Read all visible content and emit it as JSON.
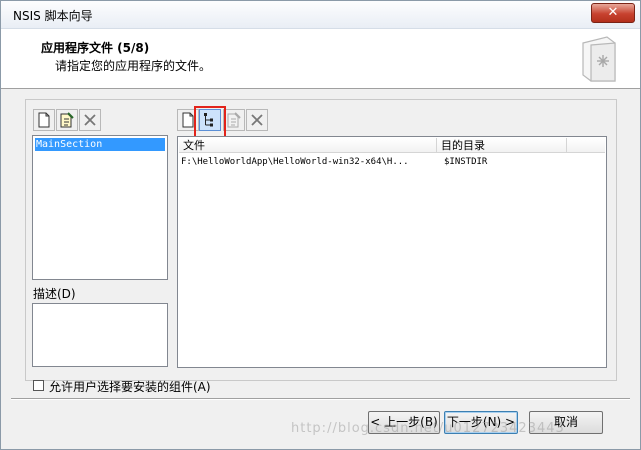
{
  "window": {
    "title": "NSIS 脚本向导",
    "close_glyph": "✕"
  },
  "header": {
    "title": "应用程序文件 (5/8)",
    "subtitle": "请指定您的应用程序的文件。",
    "icon": "wizard-page-icon"
  },
  "sections": {
    "toolbar": [
      "new-section-icon",
      "rename-section-icon",
      "delete-section-icon"
    ],
    "items": [
      "MainSection"
    ],
    "selected_index": 0
  },
  "description": {
    "label": "描述(D)"
  },
  "files": {
    "toolbar": [
      "add-file-icon",
      "add-directory-tree-icon",
      "edit-file-icon",
      "delete-file-icon"
    ],
    "columns": [
      "文件",
      "目的目录"
    ],
    "rows": [
      {
        "file": "F:\\HelloWorldApp\\HelloWorld-win32-x64\\H...",
        "dest": "$INSTDIR"
      }
    ]
  },
  "allow_select": {
    "label": "允许用户选择要安装的组件(A)",
    "checked": false
  },
  "buttons": {
    "back": "< 上一步(B)",
    "next": "下一步(N) >",
    "cancel": "取消"
  },
  "watermark": "http://blog.csdn.net/u012723423443"
}
